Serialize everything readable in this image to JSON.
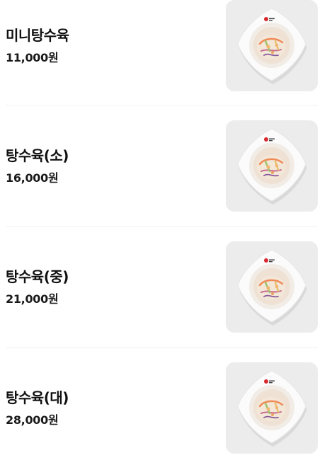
{
  "menu": {
    "items": [
      {
        "name": "미니탕수육",
        "price": "11,000원",
        "image_icon": "food-plate-icon"
      },
      {
        "name": "탕수육(소)",
        "price": "16,000원",
        "image_icon": "food-plate-icon"
      },
      {
        "name": "탕수육(중)",
        "price": "21,000원",
        "image_icon": "food-plate-icon"
      },
      {
        "name": "탕수육(대)",
        "price": "28,000원",
        "image_icon": "food-plate-icon"
      }
    ]
  },
  "colors": {
    "text": "#111111",
    "thumb_bg": "#ececec",
    "divider": "#f0f0f0",
    "plate": "#fbfbfb",
    "plate_logo": "#d8282e"
  }
}
